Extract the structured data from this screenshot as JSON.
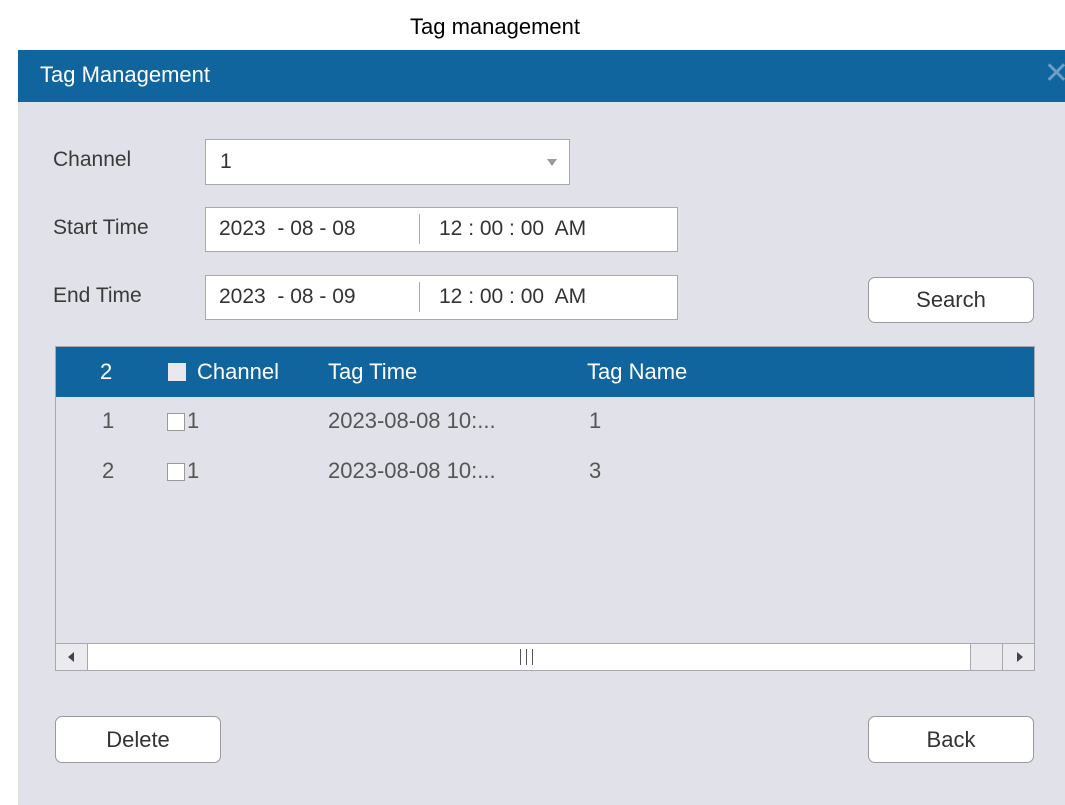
{
  "caption": "Tag management",
  "window": {
    "title": "Tag Management",
    "close_icon": "close-icon"
  },
  "form": {
    "channel": {
      "label": "Channel",
      "value": "1"
    },
    "start_time": {
      "label": "Start Time",
      "date": "2023  - 08 - 08",
      "time": "12 : 00 : 00  AM"
    },
    "end_time": {
      "label": "End Time",
      "date": "2023  - 08 - 09",
      "time": "12 : 00 : 00  AM"
    },
    "search_label": "Search"
  },
  "table": {
    "header": {
      "count": "2",
      "channel": "Channel",
      "tag_time": "Tag Time",
      "tag_name": "Tag Name"
    },
    "rows": [
      {
        "index": "1",
        "channel": "1",
        "tag_time": "2023-08-08 10:...",
        "tag_name": "1"
      },
      {
        "index": "2",
        "channel": "1",
        "tag_time": "2023-08-08 10:...",
        "tag_name": "3"
      }
    ]
  },
  "buttons": {
    "delete_label": "Delete",
    "back_label": "Back"
  },
  "colors": {
    "accent": "#11659e",
    "panel": "#e1e1e9"
  }
}
